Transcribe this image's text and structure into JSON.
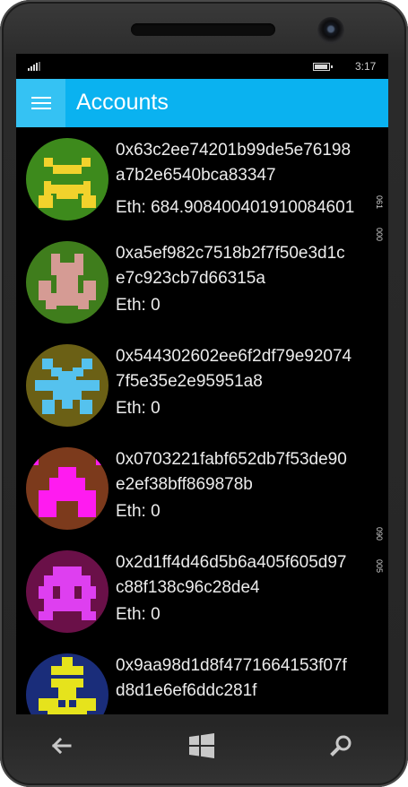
{
  "status_bar": {
    "time": "3:17",
    "signal_icon": "signal-bars-icon",
    "battery_icon": "battery-icon"
  },
  "app_bar": {
    "title": "Accounts",
    "menu_icon": "hamburger-menu-icon",
    "color": "#0ab2f0"
  },
  "accounts": [
    {
      "address_line1": "0x63c2ee74201b99de5e76198",
      "address_line2": "a7b2e6540bca83347",
      "balance": "Eth: 684.908400401910084601",
      "avatar_bg": "#3d8a1c",
      "avatar_fg": "#f2d22c"
    },
    {
      "address_line1": "0xa5ef982c7518b2f7f50e3d1c",
      "address_line2": "e7c923cb7d66315a",
      "balance": "Eth: 0",
      "avatar_bg": "#3f7d1c",
      "avatar_fg": "#d59b94"
    },
    {
      "address_line1": "0x544302602ee6f2df79e92074",
      "address_line2": "7f5e35e2e95951a8",
      "balance": "Eth: 0",
      "avatar_bg": "#6b6015",
      "avatar_fg": "#55c2ee"
    },
    {
      "address_line1": "0x0703221fabf652db7f53de90",
      "address_line2": "e2ef38bff869878b",
      "balance": "Eth: 0",
      "avatar_bg": "#7c3a1c",
      "avatar_fg": "#ff1bf0"
    },
    {
      "address_line1": "0x2d1ff4d46d5b6a405f605d97",
      "address_line2": "c88f138c96c28de4",
      "balance": "Eth: 0",
      "avatar_bg": "#6a1048",
      "avatar_fg": "#de3ff0"
    },
    {
      "address_line1": "0x9aa98d1d8f4771664153f07f",
      "address_line2": "d8d1e6ef6ddc281f",
      "balance": "",
      "avatar_bg": "#1a2d7a",
      "avatar_fg": "#e6e31c"
    }
  ],
  "side_marks": [
    "061",
    "000",
    "090",
    "005"
  ],
  "nav": {
    "back_icon": "back-arrow-icon",
    "windows_icon": "windows-logo-icon",
    "search_icon": "search-icon"
  }
}
